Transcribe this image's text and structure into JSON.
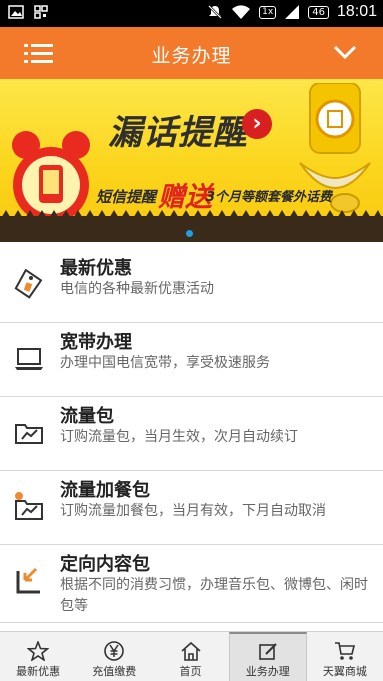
{
  "status_bar": {
    "network_badge": "1x",
    "battery_level": "46",
    "time": "18:01"
  },
  "header": {
    "title": "业务办理"
  },
  "banner": {
    "headline": "漏话提醒",
    "sub_left": "短信提醒",
    "sub_highlight": "赠送",
    "sub_right": "3个月等额套餐外话费"
  },
  "services": [
    {
      "title": "最新优惠",
      "description": "电信的各种最新优惠活动"
    },
    {
      "title": "宽带办理",
      "description": "办理中国电信宽带，享受极速服务"
    },
    {
      "title": "流量包",
      "description": "订购流量包，当月生效，次月自动续订"
    },
    {
      "title": "流量加餐包",
      "description": "订购流量加餐包，当月有效，下月自动取消"
    },
    {
      "title": "定向内容包",
      "description": "根据不同的消费习惯，办理音乐包、微博包、闲时包等"
    }
  ],
  "bottom_nav": [
    {
      "label": "最新优惠",
      "icon": "star-icon"
    },
    {
      "label": "充值缴费",
      "icon": "yen-icon"
    },
    {
      "label": "首页",
      "icon": "home-icon"
    },
    {
      "label": "业务办理",
      "icon": "edit-icon",
      "active": true
    },
    {
      "label": "天翼商城",
      "icon": "cart-icon"
    }
  ],
  "colors": {
    "header_bg": "#f47a2b",
    "banner_bg": "#fbd51c",
    "accent_red": "#e0231f"
  }
}
